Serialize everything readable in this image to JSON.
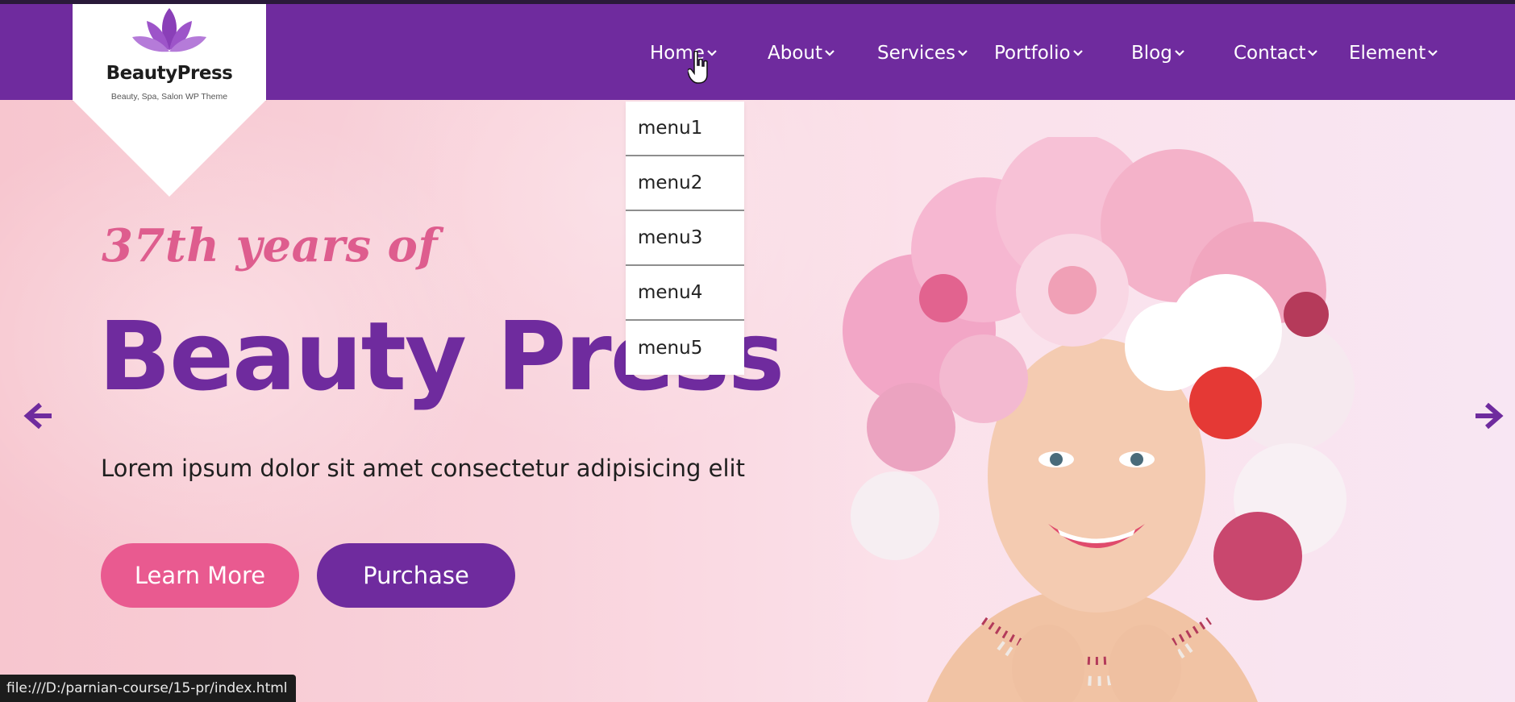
{
  "logo": {
    "name": "BeautyPress",
    "tagline": "Beauty, Spa, Salon WP Theme"
  },
  "nav": {
    "items": [
      {
        "label": "Home",
        "has_dropdown": true
      },
      {
        "label": "About",
        "has_dropdown": true
      },
      {
        "label": "Services",
        "has_dropdown": true
      },
      {
        "label": "Portfolio",
        "has_dropdown": true
      },
      {
        "label": "Blog",
        "has_dropdown": true
      },
      {
        "label": "Contact",
        "has_dropdown": true
      },
      {
        "label": "Element",
        "has_dropdown": true
      }
    ]
  },
  "dropdown": {
    "items": [
      "menu1",
      "menu2",
      "menu3",
      "menu4",
      "menu5"
    ]
  },
  "hero": {
    "subtitle": "37th years of",
    "title": "Beauty Press",
    "lead": "Lorem ipsum dolor sit amet consectetur adipisicing elit",
    "buttons": {
      "learn_more": "Learn More",
      "purchase": "Purchase"
    }
  },
  "status_bar": {
    "url": "file:///D:/parnian-course/15-pr/index.html"
  },
  "colors": {
    "brand_purple": "#6f2b9e",
    "accent_pink": "#e95a90",
    "subtitle_pink": "#de5d8e",
    "hero_bg": "#f9d3dc"
  },
  "icons": [
    "lotus-logo-icon",
    "chevron-down-icon",
    "arrow-left-icon",
    "arrow-right-icon",
    "hand-pointer-icon"
  ]
}
